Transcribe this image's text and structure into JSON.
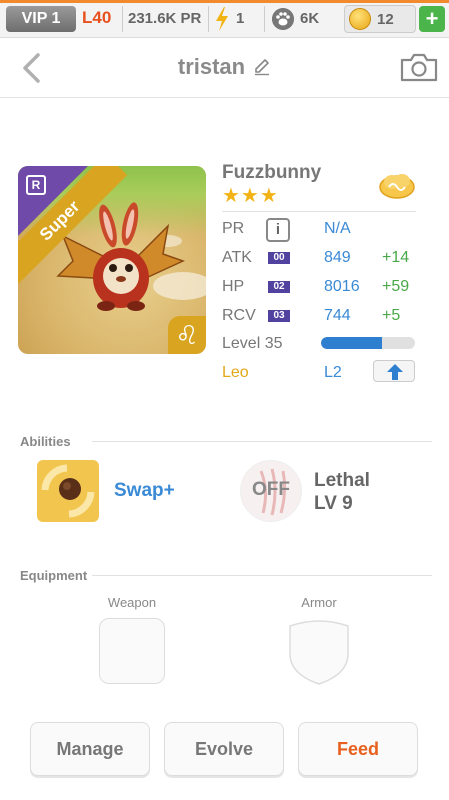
{
  "status_bar": {
    "vip": "VIP 1",
    "level": "L40",
    "power": "231.6K PR",
    "energy": "1",
    "pets": "6K",
    "coins": "12",
    "add_label": "+",
    "accent_color": "#f08a2c"
  },
  "header": {
    "title": "tristan",
    "back_icon": "chevron-left-icon",
    "edit_icon": "pencil-icon",
    "camera_icon": "camera-icon"
  },
  "pet": {
    "name": "Fuzzbunny",
    "stars": "★★★",
    "rarity_badge": "R",
    "tier": "Super",
    "zodiac_glyph": "♌",
    "element_icon": "cloud-icon",
    "pr_label": "PR",
    "pr_info": "i",
    "pr_value": "N/A",
    "stats": [
      {
        "label": "ATK",
        "box": "00",
        "value": "849",
        "bonus": "+14"
      },
      {
        "label": "HP",
        "box": "02",
        "value": "8016",
        "bonus": "+59"
      },
      {
        "label": "RCV",
        "box": "03",
        "value": "744",
        "bonus": "+5"
      }
    ],
    "level_label": "Level 35",
    "level_progress": 0.65,
    "sign": "Leo",
    "sign_level": "L2"
  },
  "abilities": {
    "title": "Abilities",
    "items": [
      {
        "name": "Swap+"
      },
      {
        "state": "OFF",
        "name": "Lethal",
        "level": "LV 9"
      }
    ]
  },
  "equipment": {
    "title": "Equipment",
    "weapon_label": "Weapon",
    "armor_label": "Armor"
  },
  "actions": {
    "manage": "Manage",
    "evolve": "Evolve",
    "feed": "Feed"
  }
}
